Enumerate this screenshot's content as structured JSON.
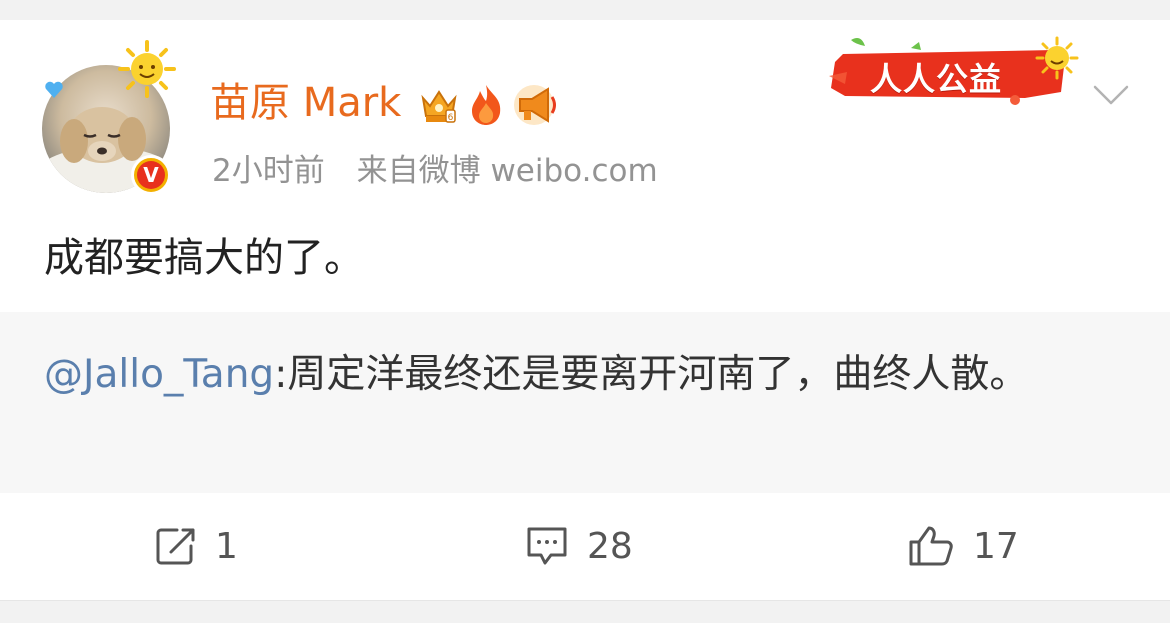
{
  "post": {
    "author": "苗原 Mark",
    "time": "2小时前",
    "source": "来自微博 weibo.com",
    "content": "成都要搞大的了。",
    "badges": [
      "crown-badge-icon",
      "fire-badge-icon",
      "megaphone-badge-icon"
    ],
    "verified": "V",
    "charity_label": "人人公益"
  },
  "repost": {
    "mention": "@Jallo_Tang",
    "text": ":周定洋最终还是要离开河南了，曲终人散。"
  },
  "actions": {
    "share_count": "1",
    "comment_count": "28",
    "like_count": "17"
  },
  "colors": {
    "username": "#e86a1e",
    "mention": "#5a7fad",
    "meta": "#939393",
    "charity_red": "#e8311d"
  }
}
